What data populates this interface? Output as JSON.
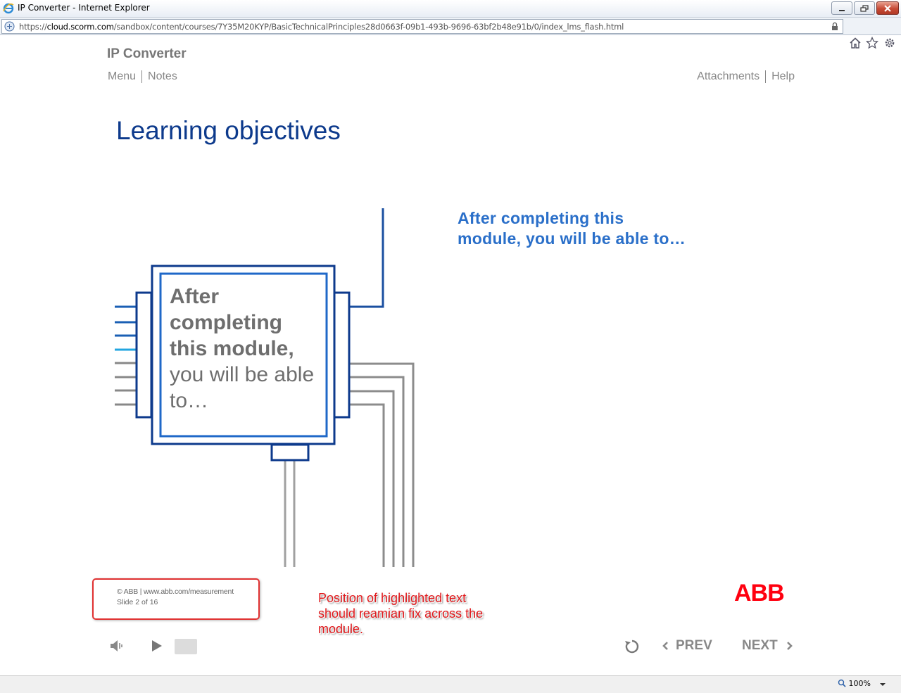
{
  "browser": {
    "window_title": "IP Converter - Internet Explorer",
    "url_prefix": "https://",
    "url_host": "cloud.scorm.com",
    "url_path": "/sandbox/content/courses/7Y35M20KYP/BasicTechnicalPrinciples28d0663f-09b1-493b-9696-63bf2b48e91b/0/index_lms_flash.html",
    "zoom": "100%"
  },
  "course": {
    "title": "IP Converter",
    "nav_left": [
      "Menu",
      "Notes"
    ],
    "nav_right": [
      "Attachments",
      "Help"
    ]
  },
  "slide": {
    "heading": "Learning objectives",
    "callout_line1": "After completing this",
    "callout_line2": "module, you will be able to…",
    "chip_bold_1": "After",
    "chip_bold_2": "completing",
    "chip_bold_3": "this module,",
    "chip_normal_1": "you will be able",
    "chip_normal_2": "to…"
  },
  "footer": {
    "copyright": "© ABB | www.abb.com/measurement",
    "slide_counter": "Slide 2 of 16",
    "logo": "ABB"
  },
  "annotation": {
    "text": "Position of highlighted text should reamian fix across the module."
  },
  "controls": {
    "prev_label": "PREV",
    "next_label": "NEXT",
    "icons": [
      "volume-icon",
      "play-icon",
      "replay-icon"
    ]
  },
  "colors": {
    "heading": "#0d3a8c",
    "callout": "#2a6fc9",
    "annotation_red": "#e0191c",
    "abb_red": "#ff000f"
  }
}
